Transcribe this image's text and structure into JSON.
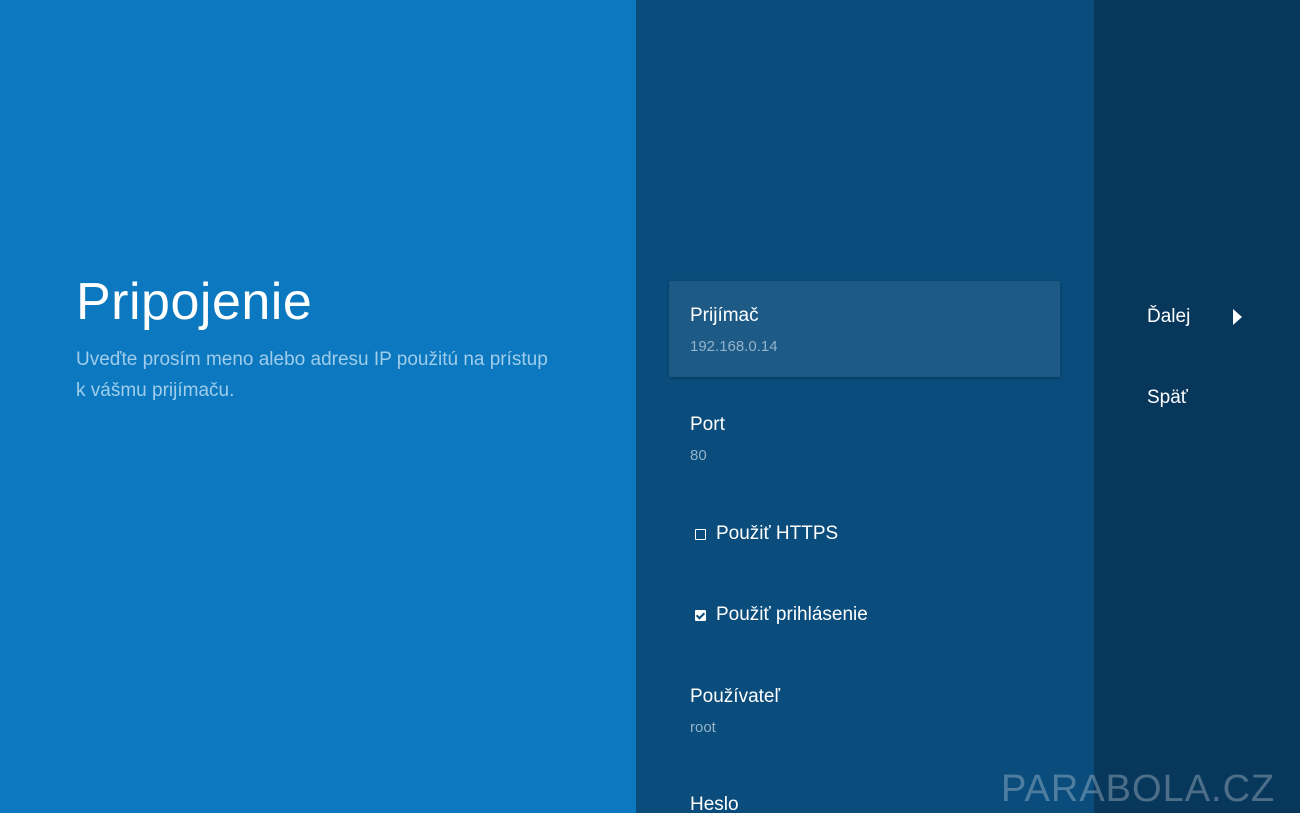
{
  "left": {
    "title": "Pripojenie",
    "description": "Uveďte prosím meno alebo adresu IP použitú na prístup k vášmu prijímaču."
  },
  "settings": {
    "receiver": {
      "title": "Prijímač",
      "value": "192.168.0.14"
    },
    "port": {
      "title": "Port",
      "value": "80"
    },
    "https": {
      "label": "Použiť HTTPS",
      "checked": false
    },
    "login": {
      "label": "Použiť prihlásenie",
      "checked": true
    },
    "user": {
      "title": "Používateľ",
      "value": "root"
    },
    "password": {
      "title": "Heslo"
    }
  },
  "actions": {
    "next": "Ďalej",
    "back": "Späť"
  },
  "watermark": "PARABOLA.CZ",
  "colors": {
    "left_bg": "#0b78bf",
    "middle_bg": "#0a4c7b",
    "right_bg": "#08375c",
    "focused_item_bg": "#1d5a85"
  }
}
